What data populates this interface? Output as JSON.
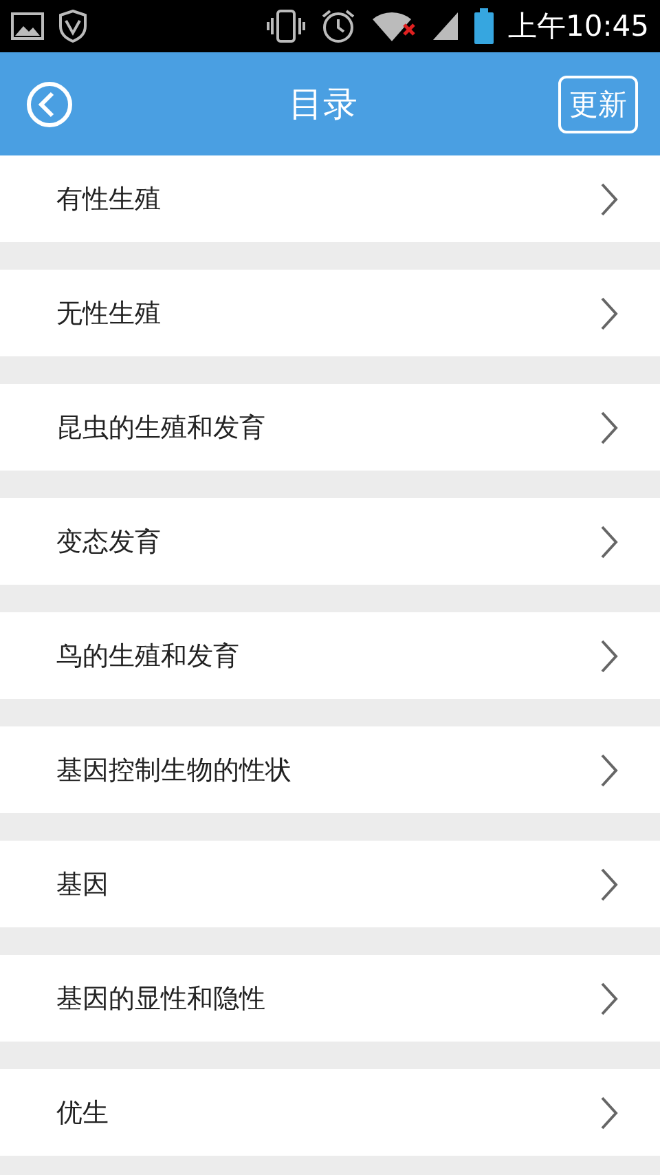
{
  "status_bar": {
    "time": "上午10:45"
  },
  "header": {
    "title": "目录",
    "action": "更新"
  },
  "items": [
    {
      "label": "有性生殖"
    },
    {
      "label": "无性生殖"
    },
    {
      "label": "昆虫的生殖和发育"
    },
    {
      "label": "变态发育"
    },
    {
      "label": "鸟的生殖和发育"
    },
    {
      "label": "基因控制生物的性状"
    },
    {
      "label": "基因"
    },
    {
      "label": "基因的显性和隐性"
    },
    {
      "label": "优生"
    }
  ]
}
